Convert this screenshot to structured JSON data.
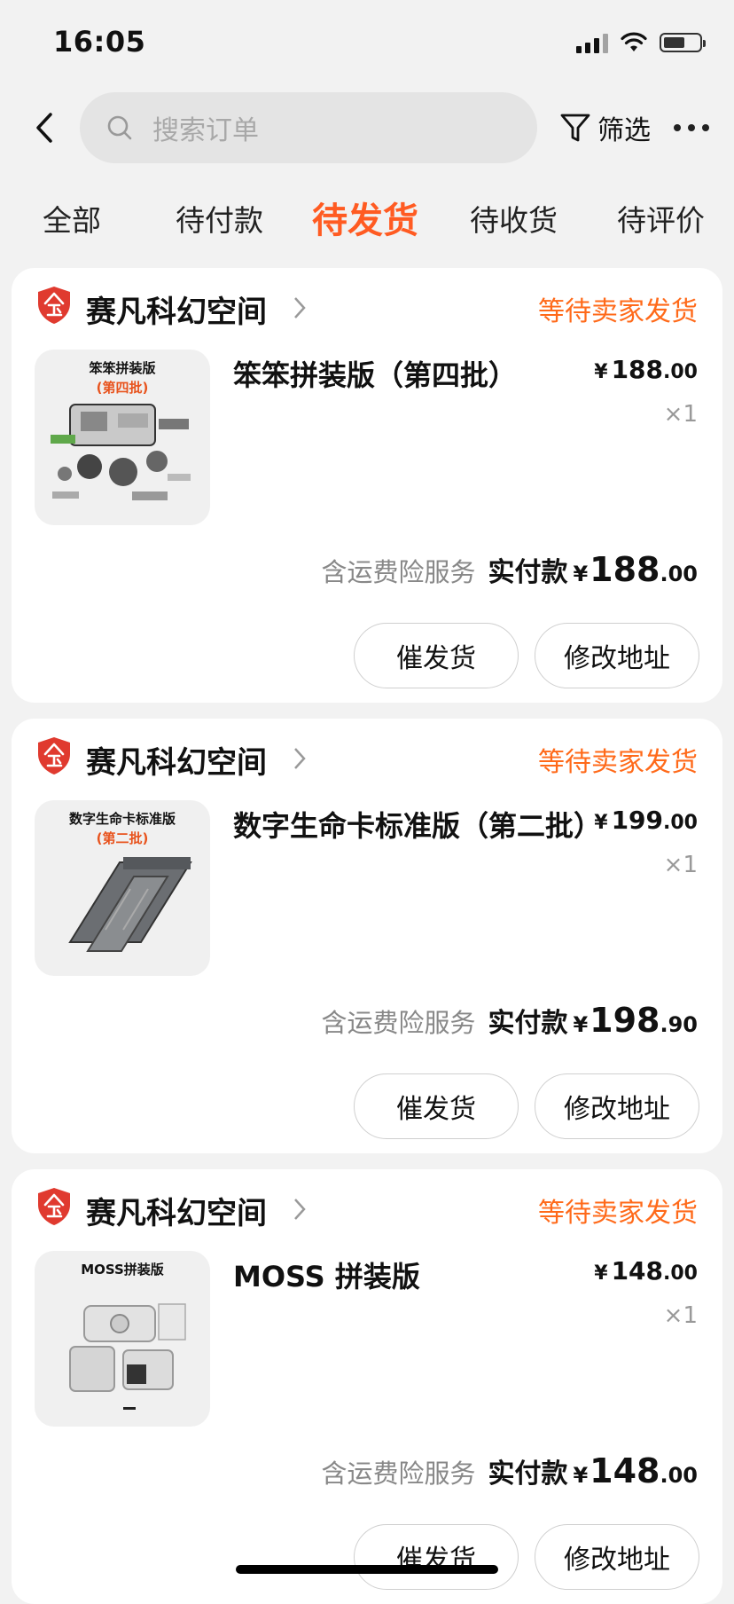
{
  "status_bar": {
    "time": "16:05",
    "battery_level": 0.6
  },
  "header": {
    "search_placeholder": "搜索订单",
    "filter_label": "筛选"
  },
  "tabs": [
    {
      "label": "全部",
      "active": false
    },
    {
      "label": "待付款",
      "active": false
    },
    {
      "label": "待发货",
      "active": true
    },
    {
      "label": "待收货",
      "active": false
    },
    {
      "label": "待评价",
      "active": false
    }
  ],
  "colors": {
    "accent": "#ff5b22",
    "status": "#ff6a1a",
    "shop_badge": "#e03a2f"
  },
  "orders": [
    {
      "shop_name": "赛凡科幻空间",
      "status": "等待卖家发货",
      "thumb_title": "笨笨拼装版",
      "thumb_sub": "(第四批)",
      "product_name": "笨笨拼装版（第四批）",
      "price_yen": "¥",
      "price_int": "188",
      "price_dec": ".00",
      "qty": "×1",
      "service_note": "含运费险服务",
      "paid_label": "实付款",
      "paid_yen": "¥",
      "paid_int": "188",
      "paid_dec": ".00",
      "btn_urge": "催发货",
      "btn_address": "修改地址"
    },
    {
      "shop_name": "赛凡科幻空间",
      "status": "等待卖家发货",
      "thumb_title": "数字生命卡标准版",
      "thumb_sub": "(第二批)",
      "product_name": "数字生命卡标准版（第二批）",
      "price_yen": "¥",
      "price_int": "199",
      "price_dec": ".00",
      "qty": "×1",
      "service_note": "含运费险服务",
      "paid_label": "实付款",
      "paid_yen": "¥",
      "paid_int": "198",
      "paid_dec": ".90",
      "btn_urge": "催发货",
      "btn_address": "修改地址"
    },
    {
      "shop_name": "赛凡科幻空间",
      "status": "等待卖家发货",
      "thumb_title": "MOSS拼装版",
      "thumb_sub": "",
      "product_name": "MOSS 拼装版",
      "price_yen": "¥",
      "price_int": "148",
      "price_dec": ".00",
      "qty": "×1",
      "service_note": "含运费险服务",
      "paid_label": "实付款",
      "paid_yen": "¥",
      "paid_int": "148",
      "paid_dec": ".00",
      "btn_urge": "催发货",
      "btn_address": "修改地址"
    }
  ]
}
